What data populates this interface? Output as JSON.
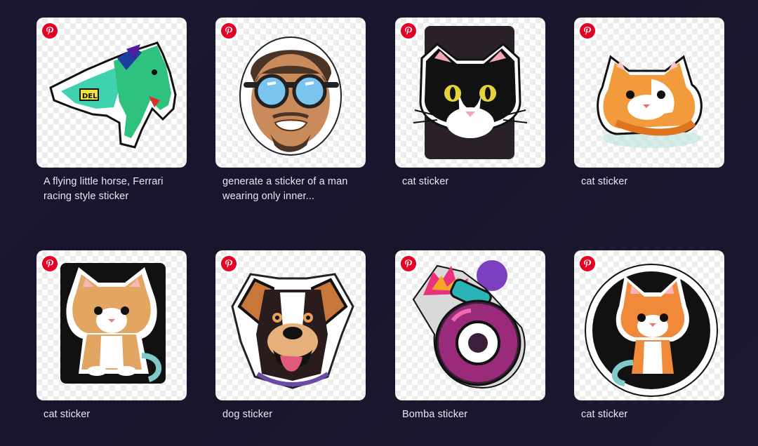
{
  "colors": {
    "background": "#1a1730",
    "caption_text": "#e9e8f2",
    "pinterest_red": "#e60023"
  },
  "badge_icon": "pinterest-icon",
  "stickers": [
    {
      "caption": "A flying little horse, Ferrari racing style sticker",
      "art": "horse"
    },
    {
      "caption": "generate a sticker of a man wearing only inner...",
      "art": "man-with-goggles"
    },
    {
      "caption": "cat sticker",
      "art": "black-white-cat"
    },
    {
      "caption": "cat sticker",
      "art": "orange-cat-lying"
    },
    {
      "caption": "cat sticker",
      "art": "sitting-kitten"
    },
    {
      "caption": "dog sticker",
      "art": "dog"
    },
    {
      "caption": "Bomba sticker",
      "art": "bomb"
    },
    {
      "caption": "cat sticker",
      "art": "orange-cat-circle"
    }
  ]
}
